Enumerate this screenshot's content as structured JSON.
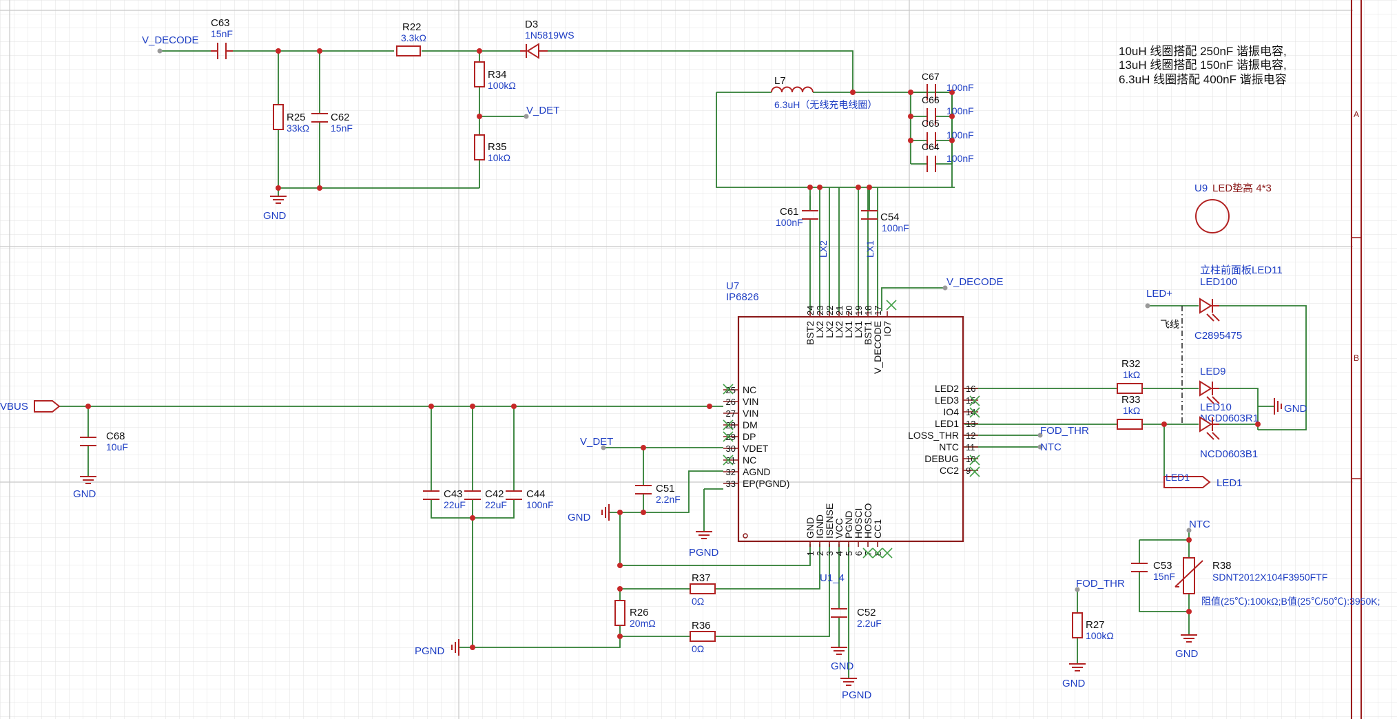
{
  "notes": {
    "line1": "10uH 线圈搭配 250nF 谐振电容,",
    "line2": "13uH 线圈搭配 150nF 谐振电容,",
    "line3": "6.3uH 线圈搭配 400nF 谐振电容"
  },
  "frame": {
    "zone_a": "A",
    "zone_b": "B"
  },
  "ic": {
    "ref": "U7",
    "part": "IP6826",
    "top_pins": [
      {
        "num": "24",
        "name": "BST2"
      },
      {
        "num": "23",
        "name": "LX2"
      },
      {
        "num": "22",
        "name": "LX2"
      },
      {
        "num": "21",
        "name": "LX2"
      },
      {
        "num": "20",
        "name": "LX1"
      },
      {
        "num": "19",
        "name": "LX1"
      },
      {
        "num": "18",
        "name": "BST1"
      },
      {
        "num": "17",
        "name": "V_DECODE"
      },
      {
        "num": "",
        "name": "IO7"
      }
    ],
    "left_pins": [
      {
        "num": "25",
        "name": "NC"
      },
      {
        "num": "26",
        "name": "VIN"
      },
      {
        "num": "27",
        "name": "VIN"
      },
      {
        "num": "28",
        "name": "DM"
      },
      {
        "num": "29",
        "name": "DP"
      },
      {
        "num": "30",
        "name": "VDET"
      },
      {
        "num": "31",
        "name": "NC"
      },
      {
        "num": "32",
        "name": "AGND"
      },
      {
        "num": "33",
        "name": "EP(PGND)"
      }
    ],
    "right_pins": [
      {
        "num": "16",
        "name": "LED2"
      },
      {
        "num": "15",
        "name": "LED3"
      },
      {
        "num": "14",
        "name": "IO4"
      },
      {
        "num": "13",
        "name": "LED1"
      },
      {
        "num": "12",
        "name": "LOSS_THR"
      },
      {
        "num": "11",
        "name": "NTC"
      },
      {
        "num": "10",
        "name": "DEBUG"
      },
      {
        "num": "9",
        "name": "CC2"
      }
    ],
    "bottom_pins": [
      {
        "num": "1",
        "name": "GND"
      },
      {
        "num": "2",
        "name": "IGND"
      },
      {
        "num": "3",
        "name": "ISENSE"
      },
      {
        "num": "4",
        "name": "VCC"
      },
      {
        "num": "5",
        "name": "PGND"
      },
      {
        "num": "6",
        "name": "HOSCI"
      },
      {
        "num": "7",
        "name": "HOSCO"
      },
      {
        "num": "8",
        "name": "CC1"
      }
    ]
  },
  "components": {
    "c63": {
      "ref": "C63",
      "value": "15nF"
    },
    "r22": {
      "ref": "R22",
      "value": "3.3kΩ"
    },
    "d3": {
      "ref": "D3",
      "value": "1N5819WS"
    },
    "r34": {
      "ref": "R34",
      "value": "100kΩ"
    },
    "r35": {
      "ref": "R35",
      "value": "10kΩ"
    },
    "r25": {
      "ref": "R25",
      "value": "33kΩ"
    },
    "c62": {
      "ref": "C62",
      "value": "15nF"
    },
    "l7": {
      "ref": "L7",
      "value": "6.3uH（无线充电线圈）"
    },
    "c67": {
      "ref": "C67",
      "value": "100nF"
    },
    "c66": {
      "ref": "C66",
      "value": "100nF"
    },
    "c65": {
      "ref": "C65",
      "value": "100nF"
    },
    "c64": {
      "ref": "C64",
      "value": "100nF"
    },
    "c61": {
      "ref": "C61",
      "value": "100nF"
    },
    "c54": {
      "ref": "C54",
      "value": "100nF"
    },
    "c68": {
      "ref": "C68",
      "value": "10uF"
    },
    "c43": {
      "ref": "C43",
      "value": "22uF"
    },
    "c42": {
      "ref": "C42",
      "value": "22uF"
    },
    "c44": {
      "ref": "C44",
      "value": "100nF"
    },
    "c51": {
      "ref": "C51",
      "value": "2.2nF"
    },
    "r37": {
      "ref": "R37",
      "value": "0Ω"
    },
    "r36": {
      "ref": "R36",
      "value": "0Ω"
    },
    "r26": {
      "ref": "R26",
      "value": "20mΩ"
    },
    "c52": {
      "ref": "C52",
      "value": "2.2uF"
    },
    "r32": {
      "ref": "R32",
      "value": "1kΩ"
    },
    "r33": {
      "ref": "R33",
      "value": "1kΩ"
    },
    "led11": {
      "ref": "立柱前面板LED11",
      "value": "LED100",
      "part": "C2895475"
    },
    "led9": {
      "ref": "LED9",
      "value": "NCD0603R1"
    },
    "led10": {
      "ref": "LED10",
      "value": "NCD0603B1"
    },
    "u9": {
      "ref": "U9",
      "value": "LED垫高 4*3"
    },
    "c53": {
      "ref": "C53",
      "value": "15nF"
    },
    "r38": {
      "ref": "R38",
      "value": "SDNT2012X104F3950FTF",
      "spec": "阻值(25℃):100kΩ;B值(25℃/50℃):3950K;"
    },
    "r27": {
      "ref": "R27",
      "value": "100kΩ"
    }
  },
  "nets": {
    "v_decode": "V_DECODE",
    "v_det": "V_DET",
    "vbus": "VBUS",
    "gnd": "GND",
    "pgnd": "PGND",
    "lx1": "LX1",
    "lx2": "LX2",
    "fod_thr": "FOD_THR",
    "ntc": "NTC",
    "led1": "LED1",
    "led_plus": "LED+",
    "u1_4": "U1_4",
    "flywire": "飞线"
  }
}
